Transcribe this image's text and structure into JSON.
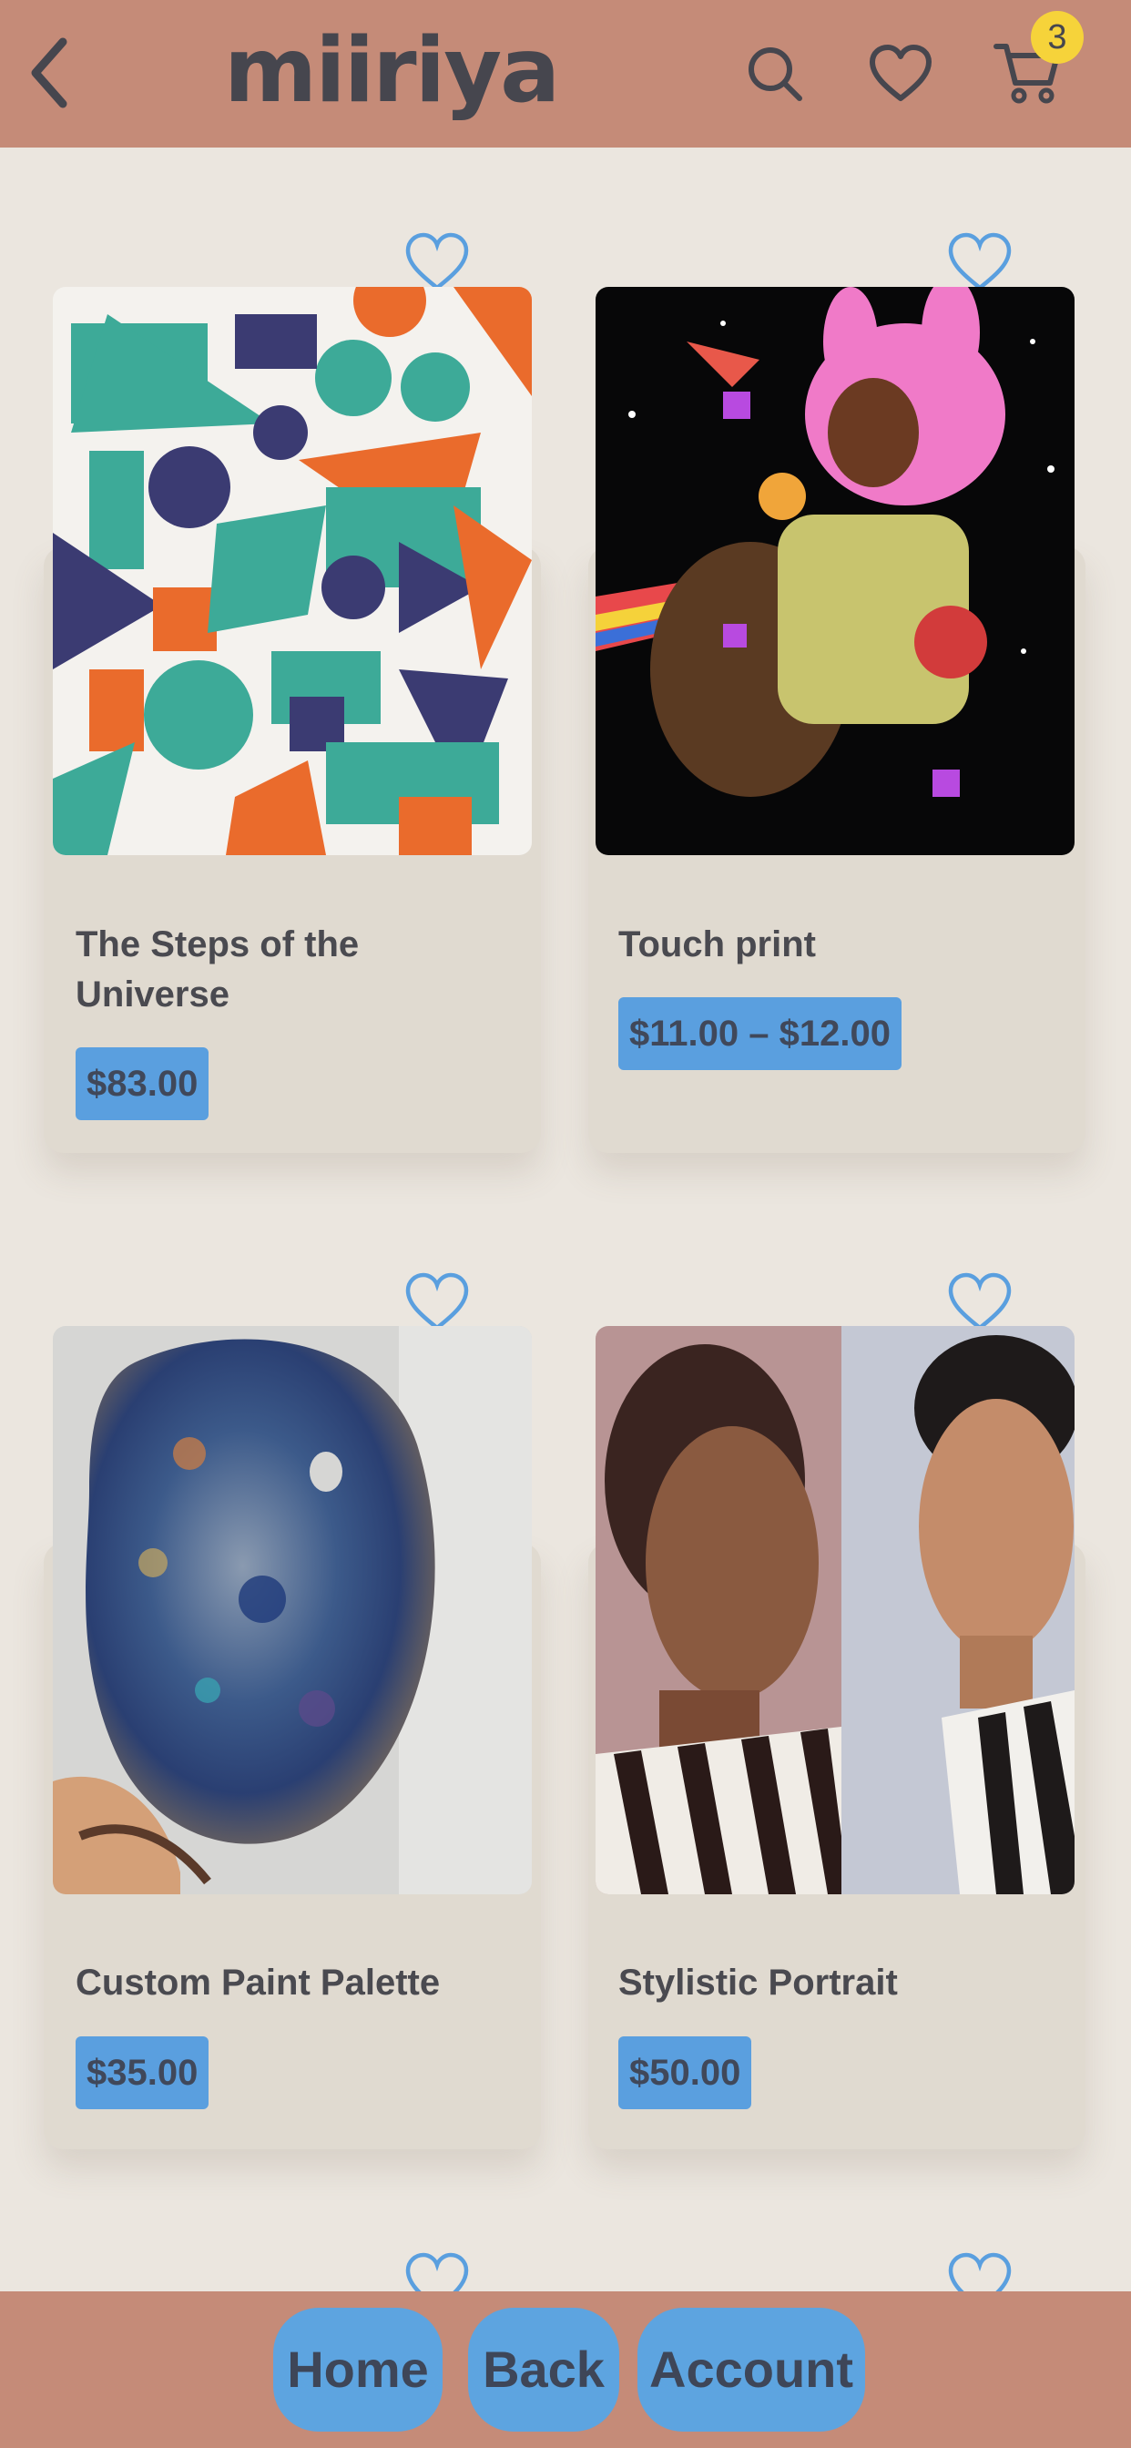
{
  "header": {
    "logo": "miiriya",
    "cart_count": "3",
    "icons": [
      "chevron-left-icon",
      "search-icon",
      "heart-icon",
      "cart-icon"
    ]
  },
  "products": [
    {
      "title": "The Steps of the Universe",
      "price": "$83.00",
      "image": "abstract-collage"
    },
    {
      "title": "Touch print",
      "price": "$11.00 – $12.00",
      "image": "illustration-bunny-hood"
    },
    {
      "title": "Custom Paint Palette",
      "price": "$35.00",
      "image": "resin-palette"
    },
    {
      "title": "Stylistic Portrait",
      "price": "$50.00",
      "image": "portrait-comparison"
    }
  ],
  "nav": {
    "home": "Home",
    "back": "Back",
    "account": "Account"
  },
  "colors": {
    "bar": "#c58b78",
    "background": "#ebe6df",
    "card": "#e0dad0",
    "accent": "#5a9fdf",
    "badge": "#f6d33a",
    "heart": "#5a9fdf"
  }
}
